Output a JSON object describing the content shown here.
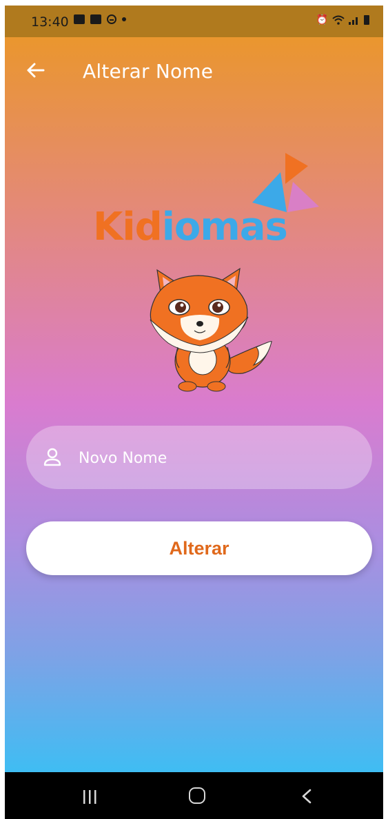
{
  "status_bar": {
    "time": "13:40"
  },
  "app_bar": {
    "title": "Alterar Nome",
    "back_icon": "arrow-left-icon"
  },
  "logo": {
    "text_part1": "Kid",
    "text_part2": "iomas",
    "colors": {
      "orange": "#f07122",
      "blue": "#3ca9e8",
      "pink": "#d97fc6"
    }
  },
  "form": {
    "name_input": {
      "placeholder": "Novo Nome",
      "value": "",
      "icon": "person-icon"
    },
    "submit_label": "Alterar"
  },
  "nav_bar": {
    "recents": "recents-icon",
    "home": "home-icon",
    "back": "back-icon"
  },
  "theme": {
    "accent": "#e0691c",
    "gradient_top": "#ea962e",
    "gradient_bottom": "#3fbdf3"
  }
}
